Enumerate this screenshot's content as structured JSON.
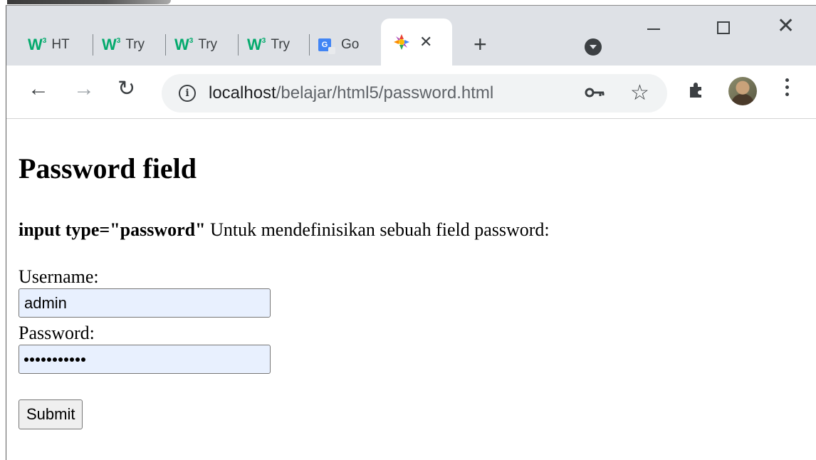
{
  "browser": {
    "tabs": [
      {
        "favicon": "w3schools-icon",
        "label": "HT"
      },
      {
        "favicon": "w3schools-icon",
        "label": "Try"
      },
      {
        "favicon": "w3schools-icon",
        "label": "Try"
      },
      {
        "favicon": "w3schools-icon",
        "label": "Try"
      },
      {
        "favicon": "google-translate-icon",
        "label": "Go"
      },
      {
        "favicon": "xampp-icon",
        "label": "",
        "active": true
      }
    ],
    "tab_close_glyph": "✕",
    "new_tab_glyph": "+",
    "url_host": "localhost",
    "url_path": "/belajar/html5/password.html"
  },
  "page": {
    "title": "Password field",
    "desc_code": "input type=\"password\"",
    "desc_text": " Untuk mendefinisikan sebuah field password:",
    "username_label": "Username:",
    "username_value": "admin",
    "password_label": "Password:",
    "password_length": 11,
    "submit_label": "Submit"
  },
  "colors": {
    "tabstrip_bg": "#dee1e6",
    "w3_green": "#04aa6d",
    "autofill_bg": "#e8f0fe"
  }
}
